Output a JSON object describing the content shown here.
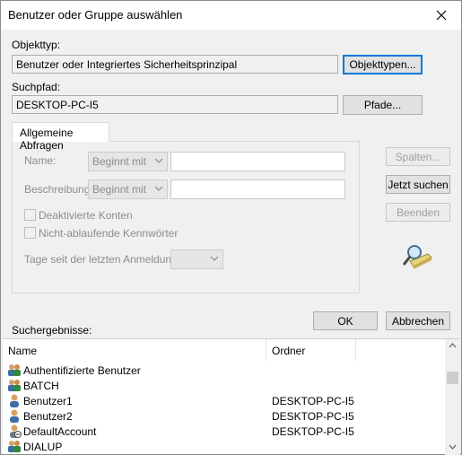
{
  "window": {
    "title": "Benutzer oder Gruppe auswählen"
  },
  "object_type": {
    "label": "Objekttyp:",
    "value": "Benutzer oder Integriertes Sicherheitsprinzipal",
    "button": "Objekttypen..."
  },
  "search_path": {
    "label": "Suchpfad:",
    "value": "DESKTOP-PC-I5",
    "button": "Pfade..."
  },
  "tab": {
    "label": "Allgemeine Abfragen"
  },
  "query": {
    "name_label": "Name:",
    "name_mode": "Beginnt mit",
    "name_value": "",
    "desc_label": "Beschreibung:",
    "desc_mode": "Beginnt mit",
    "desc_value": "",
    "disabled_accounts": "Deaktivierte Konten",
    "non_expiring_pw": "Nicht-ablaufende Kennwörter",
    "days_label": "Tage seit der letzten Anmeldung:",
    "days_value": ""
  },
  "side_buttons": {
    "columns": "Spalten...",
    "search_now": "Jetzt suchen",
    "stop": "Beenden"
  },
  "actions": {
    "ok": "OK",
    "cancel": "Abbrechen"
  },
  "results": {
    "label": "Suchergebnisse:",
    "columns": [
      "Name",
      "Ordner"
    ],
    "rows": [
      {
        "name": "Authentifizierte Benutzer",
        "folder": "",
        "icon": "group-icon"
      },
      {
        "name": "BATCH",
        "folder": "",
        "icon": "group-icon"
      },
      {
        "name": "Benutzer1",
        "folder": "DESKTOP-PC-I5",
        "icon": "user-icon"
      },
      {
        "name": "Benutzer2",
        "folder": "DESKTOP-PC-I5",
        "icon": "user-icon"
      },
      {
        "name": "DefaultAccount",
        "folder": "DESKTOP-PC-I5",
        "icon": "user-disabled-icon"
      },
      {
        "name": "DIALUP",
        "folder": "",
        "icon": "group-icon"
      }
    ]
  }
}
